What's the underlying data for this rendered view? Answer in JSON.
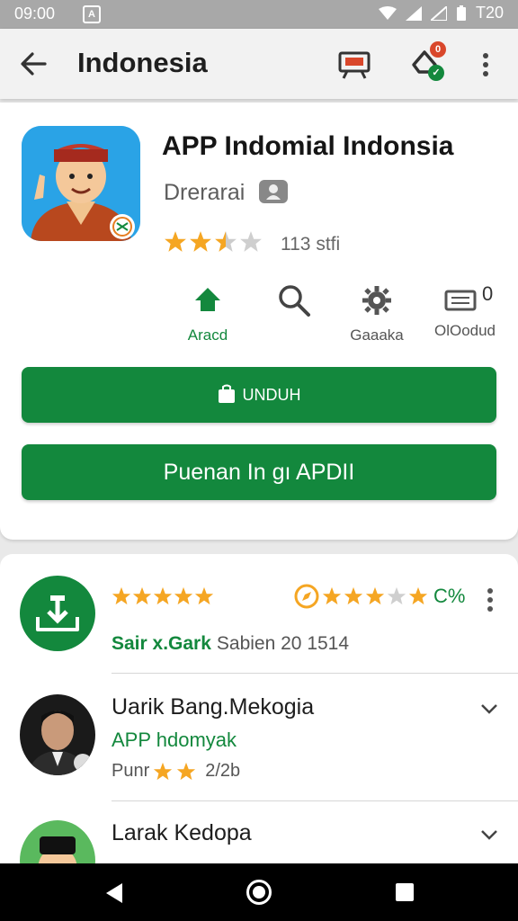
{
  "status_bar": {
    "time": "09:00",
    "battery": "T20"
  },
  "app_bar": {
    "title": "Indonesia",
    "notif_badge": "0"
  },
  "app": {
    "name": "APP Indomial Indonsia",
    "developer": "Drerarai",
    "rating_count": "113 stfi",
    "rating_stars": 2.5
  },
  "quick_actions": [
    {
      "label": "Aracd",
      "icon": "home-icon",
      "color": "#13883d"
    },
    {
      "label": "",
      "icon": "search-icon",
      "color": "#555555"
    },
    {
      "label": "Gaaaka",
      "icon": "gear-icon",
      "color": "#555555"
    },
    {
      "label": "OlOodud",
      "icon": "keyboard-icon",
      "color": "#555555",
      "badge": "0"
    }
  ],
  "buttons": {
    "primary": "UNDUH",
    "secondary": "Puenan In gı APDII"
  },
  "download_row": {
    "date_label": "Sabien 20 1514",
    "source": "Sair x.Gark",
    "rating_pct": "C%"
  },
  "reviews": [
    {
      "name": "Uarik Bang.Mekogia",
      "subtitle": "APP hdomyak",
      "meta": "Punr",
      "meta2": "2/2b"
    },
    {
      "name": "Larak Kedopa",
      "subtitle": "",
      "meta": "",
      "meta2": ""
    }
  ],
  "colors": {
    "accent": "#13883d",
    "star": "#f5a623"
  }
}
